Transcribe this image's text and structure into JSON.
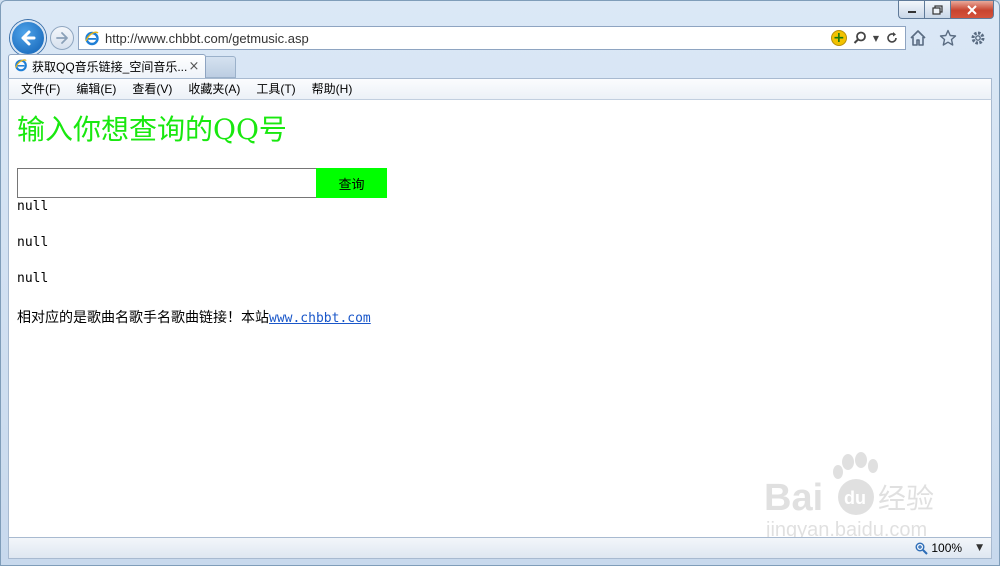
{
  "address_bar": {
    "url": "http://www.chbbt.com/getmusic.asp"
  },
  "tab": {
    "title": "获取QQ音乐链接_空间音乐...",
    "close": "×"
  },
  "menu": [
    "文件(F)",
    "编辑(E)",
    "查看(V)",
    "收藏夹(A)",
    "工具(T)",
    "帮助(H)"
  ],
  "page": {
    "heading": "输入你想查询的QQ号",
    "input_value": "",
    "button_label": "查询",
    "results": [
      "null",
      "null",
      "null"
    ],
    "footer_text": "相对应的是歌曲名歌手名歌曲链接！本站",
    "footer_link": "www.chbbt.com",
    "heading_color": "#19e80f",
    "button_color": "#00ff00"
  },
  "status_bar": {
    "zoom": "100%"
  },
  "watermark": {
    "brand": "Baidu经验",
    "url": "jingyan.baidu.com"
  }
}
